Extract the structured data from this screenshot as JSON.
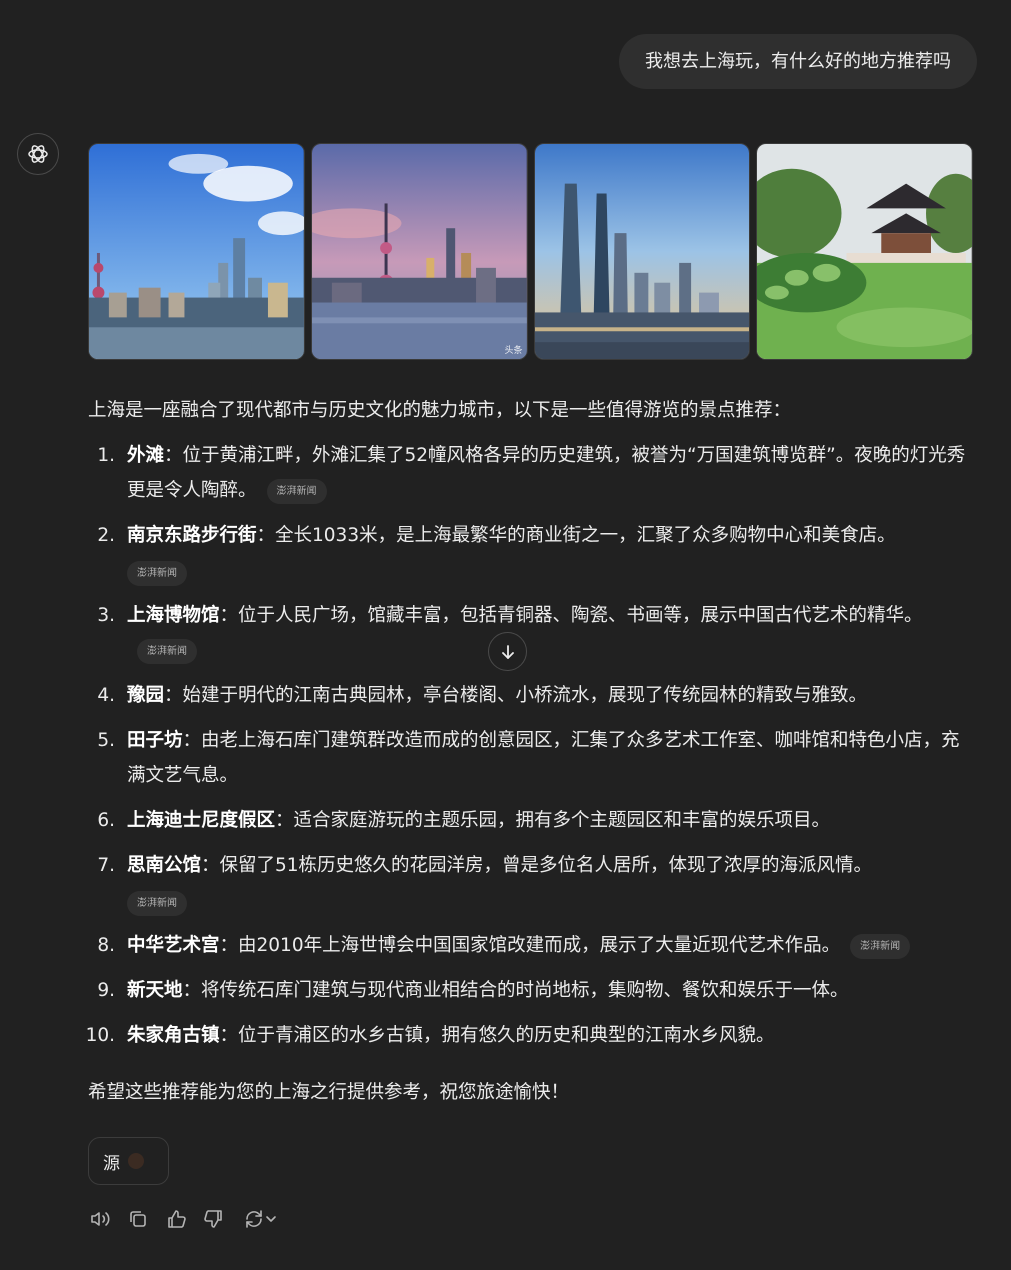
{
  "user_message": "我想去上海玩，有什么好的地方推荐吗",
  "images": [
    {
      "name": "bund-skyline-image",
      "badge": ""
    },
    {
      "name": "pudong-skyline-image",
      "badge": "头条"
    },
    {
      "name": "lujiazui-towers-image",
      "badge": ""
    },
    {
      "name": "yu-garden-image",
      "badge": ""
    }
  ],
  "intro": "上海是一座融合了现代都市与历史文化的魅力城市，以下是一些值得游览的景点推荐：",
  "items": [
    {
      "num": "1.",
      "name": "外滩",
      "desc": "：位于黄浦江畔，外滩汇集了52幢风格各异的历史建筑，被誉为“万国建筑博览群”。夜晚的灯光秀更是令人陶醉。",
      "cite": "澎湃新闻"
    },
    {
      "num": "2.",
      "name": "南京东路步行街",
      "desc": "：全长1033米，是上海最繁华的商业街之一，汇聚了众多购物中心和美食店。",
      "cite": "澎湃新闻"
    },
    {
      "num": "3.",
      "name": "上海博物馆",
      "desc": "：位于人民广场，馆藏丰富，包括青铜器、陶瓷、书画等，展示中国古代艺术的精华。",
      "cite": "澎湃新闻"
    },
    {
      "num": "4.",
      "name": "豫园",
      "desc": "：始建于明代的江南古典园林，亭台楼阁、小桥流水，展现了传统园林的精致与雅致。",
      "cite": ""
    },
    {
      "num": "5.",
      "name": "田子坊",
      "desc": "：由老上海石库门建筑群改造而成的创意园区，汇集了众多艺术工作室、咖啡馆和特色小店，充满文艺气息。",
      "cite": ""
    },
    {
      "num": "6.",
      "name": "上海迪士尼度假区",
      "desc": "：适合家庭游玩的主题乐园，拥有多个主题园区和丰富的娱乐项目。",
      "cite": ""
    },
    {
      "num": "7.",
      "name": "思南公馆",
      "desc": "：保留了51栋历史悠久的花园洋房，曾是多位名人居所，体现了浓厚的海派风情。",
      "cite": "澎湃新闻"
    },
    {
      "num": "8.",
      "name": "中华艺术宫",
      "desc": "：由2010年上海世博会中国国家馆改建而成，展示了大量近现代艺术作品。",
      "cite": "澎湃新闻"
    },
    {
      "num": "9.",
      "name": "新天地",
      "desc": "：将传统石库门建筑与现代商业相结合的时尚地标，集购物、餐饮和娱乐于一体。",
      "cite": ""
    },
    {
      "num": "10.",
      "name": "朱家角古镇",
      "desc": "：位于青浦区的水乡古镇，拥有悠久的历史和典型的江南水乡风貌。",
      "cite": ""
    }
  ],
  "outro": "希望这些推荐能为您的上海之行提供参考，祝您旅途愉快！",
  "source_label": "源",
  "actions": [
    "read-aloud-icon",
    "copy-icon",
    "thumbs-up-icon",
    "thumbs-down-icon",
    "regenerate-icon"
  ],
  "colors": {
    "background": "#212121",
    "bubble": "#2f2f2f",
    "text": "#ececec"
  }
}
